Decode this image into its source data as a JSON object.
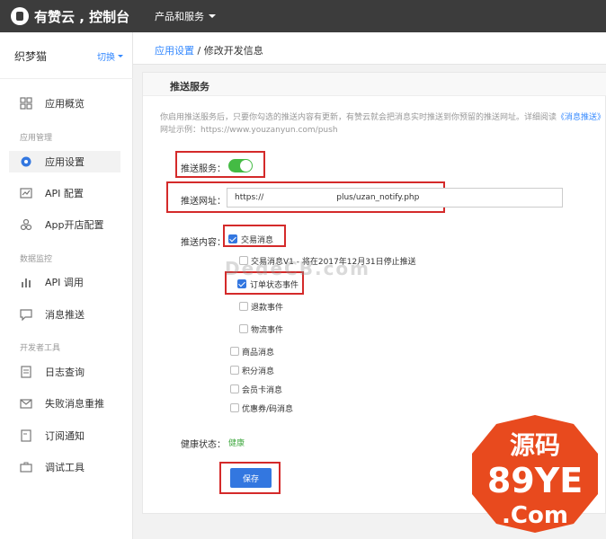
{
  "header": {
    "brand": "有赞云 , 控制台",
    "nav": "产品和服务"
  },
  "sidebar": {
    "shop_name": "织梦猫",
    "switch_label": "切换",
    "items": [
      {
        "label": "应用概览",
        "icon": "grid-icon"
      },
      {
        "label": "应用设置",
        "icon": "gear-icon"
      },
      {
        "label": "API 配置",
        "icon": "api-config-icon"
      },
      {
        "label": "App开店配置",
        "icon": "apps-icon"
      },
      {
        "label": "API 调用",
        "icon": "bar-chart-icon"
      },
      {
        "label": "消息推送",
        "icon": "message-icon"
      },
      {
        "label": "日志查询",
        "icon": "log-icon"
      },
      {
        "label": "失败消息重推",
        "icon": "resend-icon"
      },
      {
        "label": "订阅通知",
        "icon": "subscribe-icon"
      },
      {
        "label": "调试工具",
        "icon": "toolbox-icon"
      }
    ],
    "groups": [
      "应用管理",
      "数据监控",
      "开发者工具"
    ]
  },
  "breadcrumb": {
    "link": "应用设置",
    "separator": " / ",
    "current": "修改开发信息"
  },
  "panel": {
    "title": "推送服务",
    "desc_line1": "你启用推送服务后，只要你勾选的推送内容有更新，有赞云就会把消息实时推送到你预留的推送网址。详细阅读",
    "desc_link": "《消息推送》",
    "desc_line2": "网址示例：https://www.youzanyun.com/push",
    "push_service_label": "推送服务：",
    "push_service_enabled": true,
    "push_url_label": "推送网址：",
    "push_url_value": "https://         plus/uzan_notify.php",
    "push_content_label": "推送内容：",
    "options": [
      {
        "label": "交易消息",
        "checked": true
      },
      {
        "label": "交易消息V1 - 将在2017年12月31日停止推送",
        "checked": false
      },
      {
        "label": "订单状态事件",
        "checked": true
      },
      {
        "label": "退款事件",
        "checked": false
      },
      {
        "label": "物流事件",
        "checked": false
      },
      {
        "label": "商品消息",
        "checked": false
      },
      {
        "label": "积分消息",
        "checked": false
      },
      {
        "label": "会员卡消息",
        "checked": false
      },
      {
        "label": "优惠券/码消息",
        "checked": false
      }
    ],
    "health_label": "健康状态：",
    "health_value": "健康",
    "save_label": "保存"
  },
  "watermark": {
    "text": "DedeCB.com",
    "badge_line1": "源码",
    "badge_line2": "89YE",
    "badge_line3": ".Com"
  },
  "colors": {
    "accent": "#3377e0",
    "topbar": "#3c3c3c",
    "toggle_on": "#44bb44",
    "highlight": "#d42a2a",
    "badge": "#e84a1e"
  }
}
